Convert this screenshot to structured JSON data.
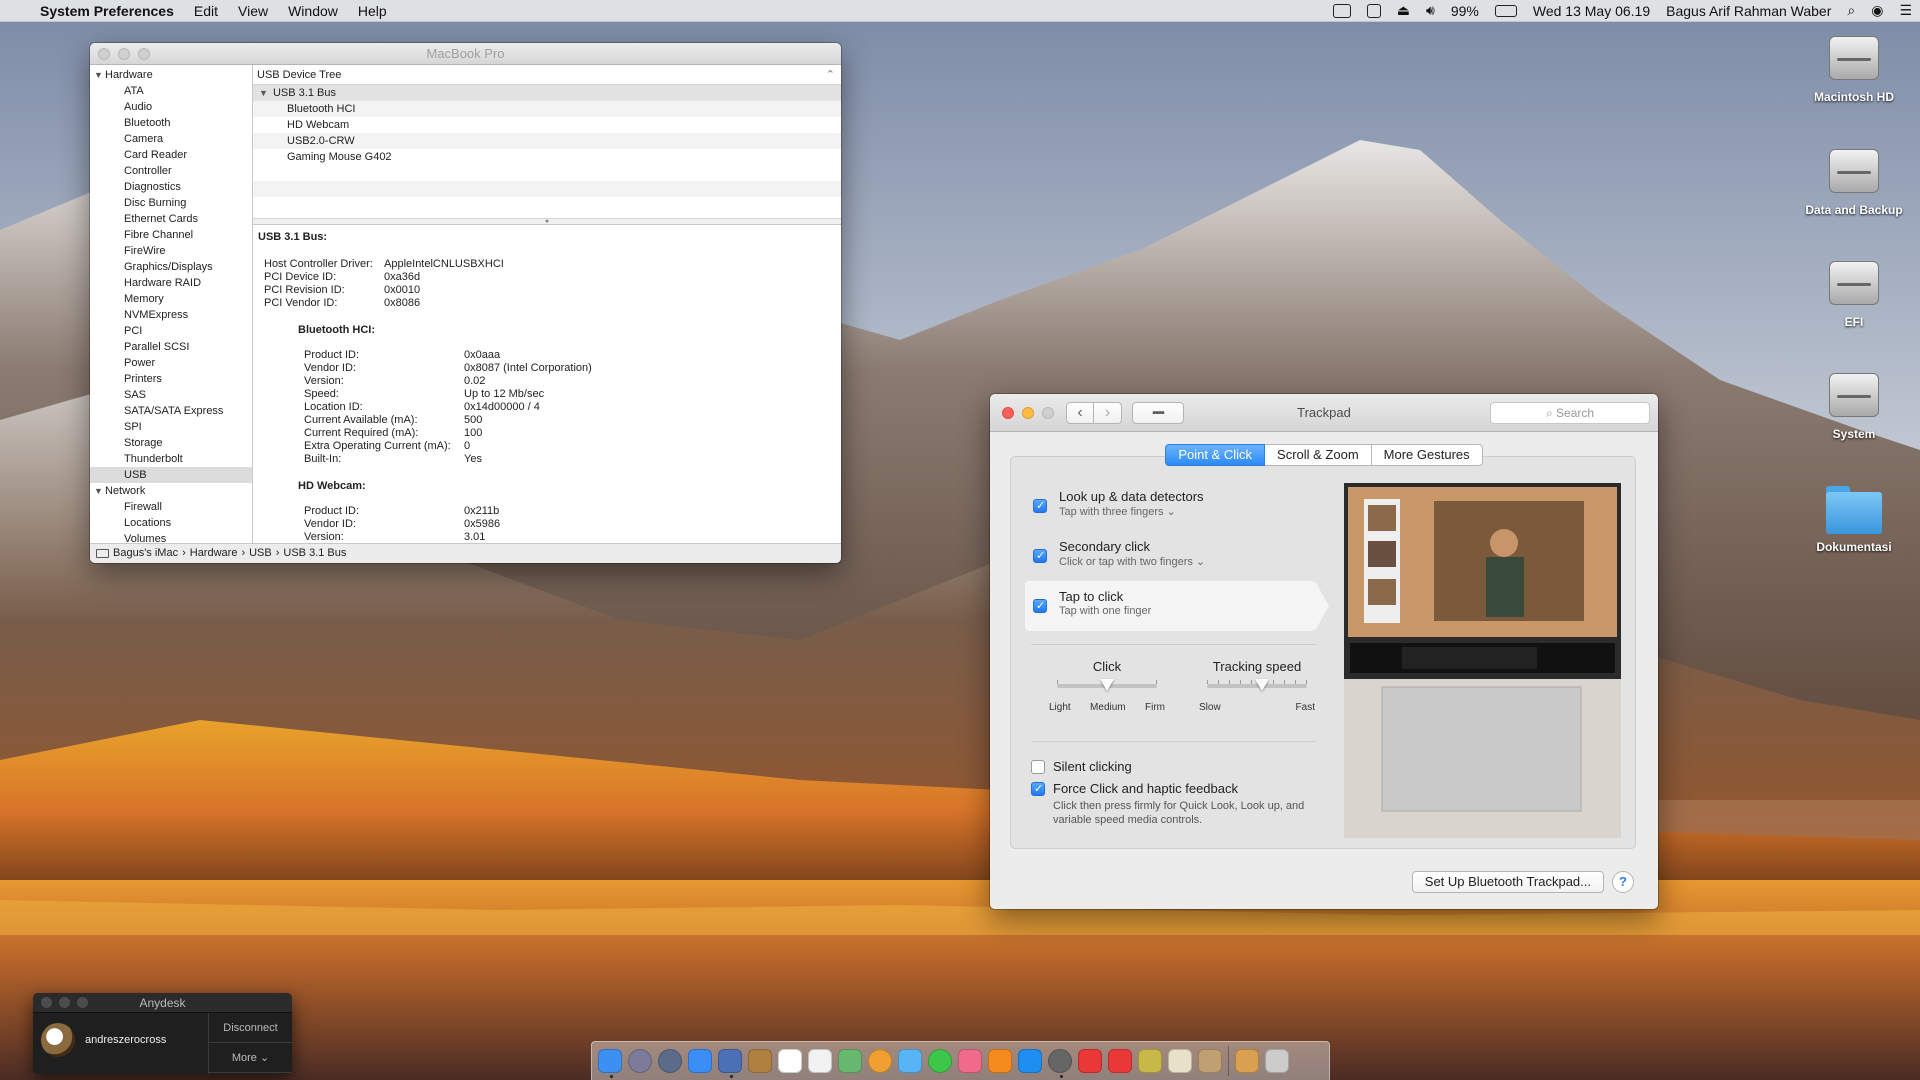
{
  "menubar": {
    "apple": "",
    "app_name": "System Preferences",
    "menus": [
      "Edit",
      "View",
      "Window",
      "Help"
    ],
    "battery": "99%",
    "datetime": "Wed 13 May  06.19",
    "user": "Bagus Arif Rahman Waber",
    "icons": [
      "screen-mirroring-icon",
      "activity-icon",
      "eject-icon",
      "volume-icon",
      "battery-icon",
      "spotlight-icon",
      "siri-icon",
      "menu-list-icon"
    ]
  },
  "desktop": {
    "icons": [
      {
        "label": "Macintosh HD",
        "type": "drive"
      },
      {
        "label": "Data and Backup",
        "type": "drive"
      },
      {
        "label": "EFI",
        "type": "drive"
      },
      {
        "label": "System",
        "type": "drive"
      },
      {
        "label": "Dokumentasi",
        "type": "folder"
      }
    ]
  },
  "sysinfo": {
    "title": "MacBook Pro",
    "sidebar": {
      "hardware_label": "Hardware",
      "hardware_items": [
        "ATA",
        "Audio",
        "Bluetooth",
        "Camera",
        "Card Reader",
        "Controller",
        "Diagnostics",
        "Disc Burning",
        "Ethernet Cards",
        "Fibre Channel",
        "FireWire",
        "Graphics/Displays",
        "Hardware RAID",
        "Memory",
        "NVMExpress",
        "PCI",
        "Parallel SCSI",
        "Power",
        "Printers",
        "SAS",
        "SATA/SATA Express",
        "SPI",
        "Storage",
        "Thunderbolt",
        "USB"
      ],
      "selected": "USB",
      "network_label": "Network",
      "network_items": [
        "Firewall",
        "Locations",
        "Volumes"
      ]
    },
    "tree": {
      "header": "USB Device Tree",
      "bus": "USB 3.1 Bus",
      "devices": [
        "Bluetooth HCI",
        "HD Webcam",
        "USB2.0-CRW",
        "Gaming Mouse G402"
      ]
    },
    "detail": {
      "heading": "USB 3.1 Bus:",
      "host": [
        {
          "k": "Host Controller Driver:",
          "v": "AppleIntelCNLUSBXHCI"
        },
        {
          "k": "PCI Device ID:",
          "v": "0xa36d"
        },
        {
          "k": "PCI Revision ID:",
          "v": "0x0010"
        },
        {
          "k": "PCI Vendor ID:",
          "v": "0x8086"
        }
      ],
      "bt_heading": "Bluetooth HCI:",
      "bt": [
        {
          "k": "Product ID:",
          "v": "0x0aaa"
        },
        {
          "k": "Vendor ID:",
          "v": "0x8087  (Intel Corporation)"
        },
        {
          "k": "Version:",
          "v": "0.02"
        },
        {
          "k": "Speed:",
          "v": "Up to 12 Mb/sec"
        },
        {
          "k": "Location ID:",
          "v": "0x14d00000 / 4"
        },
        {
          "k": "Current Available (mA):",
          "v": "500"
        },
        {
          "k": "Current Required (mA):",
          "v": "100"
        },
        {
          "k": "Extra Operating Current (mA):",
          "v": "0"
        },
        {
          "k": "Built-In:",
          "v": "Yes"
        }
      ],
      "cam_heading": "HD Webcam:",
      "cam": [
        {
          "k": "Product ID:",
          "v": "0x211b"
        },
        {
          "k": "Vendor ID:",
          "v": "0x5986"
        },
        {
          "k": "Version:",
          "v": "3.01"
        }
      ]
    },
    "path": [
      "Bagus's iMac",
      "Hardware",
      "USB",
      "USB 3.1 Bus"
    ]
  },
  "trackpad": {
    "title": "Trackpad",
    "search_placeholder": "Search",
    "tabs": [
      "Point & Click",
      "Scroll & Zoom",
      "More Gestures"
    ],
    "active_tab": "Point & Click",
    "options": [
      {
        "title": "Look up & data detectors",
        "sub": "Tap with three fingers ⌄",
        "checked": true
      },
      {
        "title": "Secondary click",
        "sub": "Click or tap with two fingers ⌄",
        "checked": true
      },
      {
        "title": "Tap to click",
        "sub": "Tap with one finger",
        "checked": true
      }
    ],
    "click": {
      "label": "Click",
      "min": "Light",
      "mid": "Medium",
      "max": "Firm",
      "level": 0.5
    },
    "tracking": {
      "label": "Tracking speed",
      "min": "Slow",
      "max": "Fast",
      "level": 0.55
    },
    "silent": {
      "label": "Silent clicking",
      "checked": false
    },
    "force": {
      "label": "Force Click and haptic feedback",
      "desc": "Click then press firmly for Quick Look, Look up, and variable speed media controls.",
      "checked": true
    },
    "setup_button": "Set Up Bluetooth Trackpad...",
    "help": "?"
  },
  "anydesk": {
    "title": "Anydesk",
    "user": "andreszerocross",
    "disconnect": "Disconnect",
    "more": "More"
  },
  "dock": {
    "colors": [
      "#3d8ff2",
      "#7c7c9a",
      "#5a6c8a",
      "#3a8ef5",
      "#4c70b6",
      "#b08040",
      "#ffffff",
      "#f2f2f2",
      "#68b870",
      "#f0a030",
      "#58b4f5",
      "#3ec64a",
      "#f06a8c",
      "#f58a1e",
      "#1e8ef2",
      "#666666",
      "#e83838",
      "#e83838",
      "#c8b848",
      "#e8e0c8",
      "#c0a070",
      "#d8a050",
      "#cccccc"
    ]
  }
}
